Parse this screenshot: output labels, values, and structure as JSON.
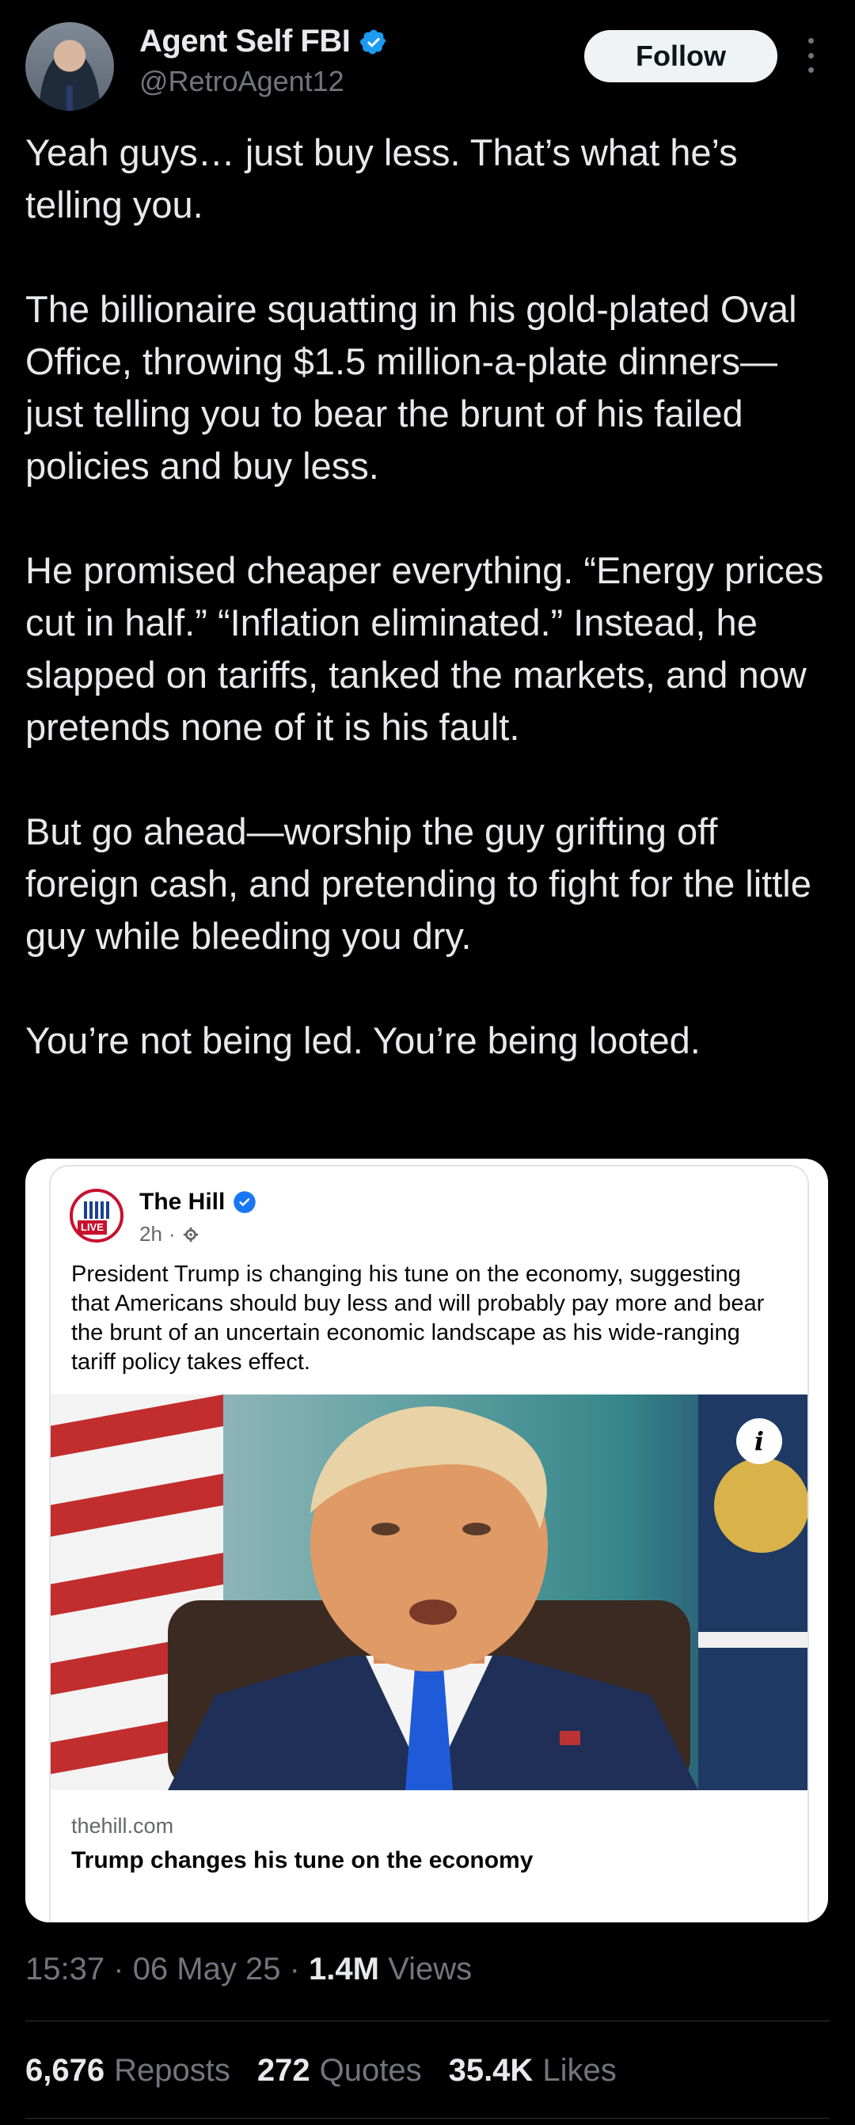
{
  "author": {
    "name": "Agent Self FBI",
    "handle": "@RetroAgent12",
    "verified": true
  },
  "follow_label": "Follow",
  "tweet": {
    "paragraphs": [
      "Yeah guys… just buy less. That’s what he’s telling you.",
      "The billionaire squatting in his gold-plated Oval Office, throwing $1.5 million-a-plate dinners—just telling you to bear the brunt of his failed policies and buy less.",
      "He promised cheaper everything. “Energy prices cut in half.” “Inflation eliminated.” Instead, he slapped on tariffs, tanked the markets, and now pretends none of it is his fault.",
      "But go ahead—worship the guy grifting off foreign cash, and pretending to fight for the little guy while bleeding you dry.",
      "You’re not being led. You’re being looted."
    ]
  },
  "embed": {
    "page_name": "The Hill",
    "logo_badge": "LIVE",
    "logo_text": "THE HILL",
    "time": "2h",
    "separator": "·",
    "post_text": "President Trump is changing his tune on the economy, suggesting that Americans should buy less and will probably pay more and bear the brunt of an uncertain economic landscape as his wide-ranging tariff policy takes effect.",
    "info_label": "i",
    "link_domain": "thehill.com",
    "link_title": "Trump changes his tune on the economy"
  },
  "meta": {
    "time": "15:37",
    "sep": "·",
    "date": "06 May 25",
    "views_count": "1.4M",
    "views_label": "Views"
  },
  "stats": {
    "reposts_count": "6,676",
    "reposts_label": "Reposts",
    "quotes_count": "272",
    "quotes_label": "Quotes",
    "likes_count": "35.4K",
    "likes_label": "Likes"
  },
  "colors": {
    "background": "#000000",
    "text": "#e7e9ea",
    "secondary": "#71767b",
    "verified_blue": "#1d9bf0",
    "hill_red": "#c8102e"
  }
}
